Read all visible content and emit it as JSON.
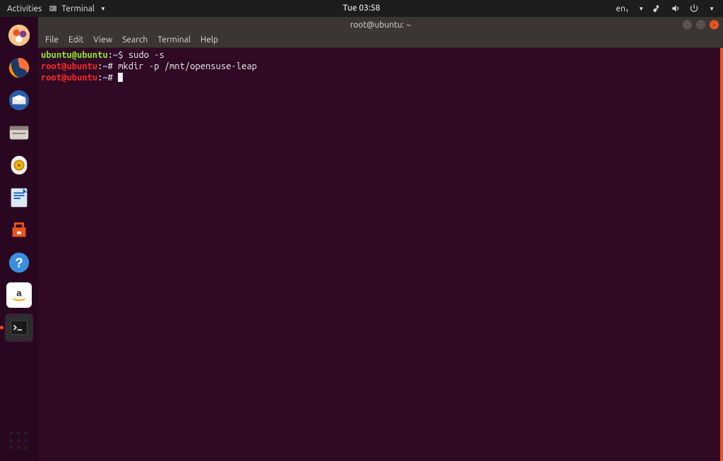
{
  "topbar": {
    "activities": "Activities",
    "app_label": "Terminal",
    "clock": "Tue 03:58",
    "input_source": "en₁"
  },
  "dock": {
    "items": [
      {
        "name": "files-icon"
      },
      {
        "name": "firefox-icon"
      },
      {
        "name": "thunderbird-icon"
      },
      {
        "name": "nautilus-icon"
      },
      {
        "name": "rhythmbox-icon"
      },
      {
        "name": "libreoffice-writer-icon"
      },
      {
        "name": "ubuntu-software-icon"
      },
      {
        "name": "help-icon"
      },
      {
        "name": "amazon-icon"
      },
      {
        "name": "terminal-icon"
      }
    ]
  },
  "window": {
    "title": "root@ubuntu: ~",
    "menu": [
      "File",
      "Edit",
      "View",
      "Search",
      "Terminal",
      "Help"
    ]
  },
  "terminal": {
    "lines": [
      {
        "prompt_user": "ubuntu@ubuntu",
        "prompt_path": "~",
        "prompt_symbol": "$",
        "cmd": "sudo -s",
        "style": "user"
      },
      {
        "prompt_user": "root@ubuntu",
        "prompt_path": "~",
        "prompt_symbol": "#",
        "cmd": "mkdir -p /mnt/opensuse-leap",
        "style": "root"
      },
      {
        "prompt_user": "root@ubuntu",
        "prompt_path": "~",
        "prompt_symbol": "#",
        "cmd": "",
        "style": "root",
        "cursor": true
      }
    ]
  }
}
